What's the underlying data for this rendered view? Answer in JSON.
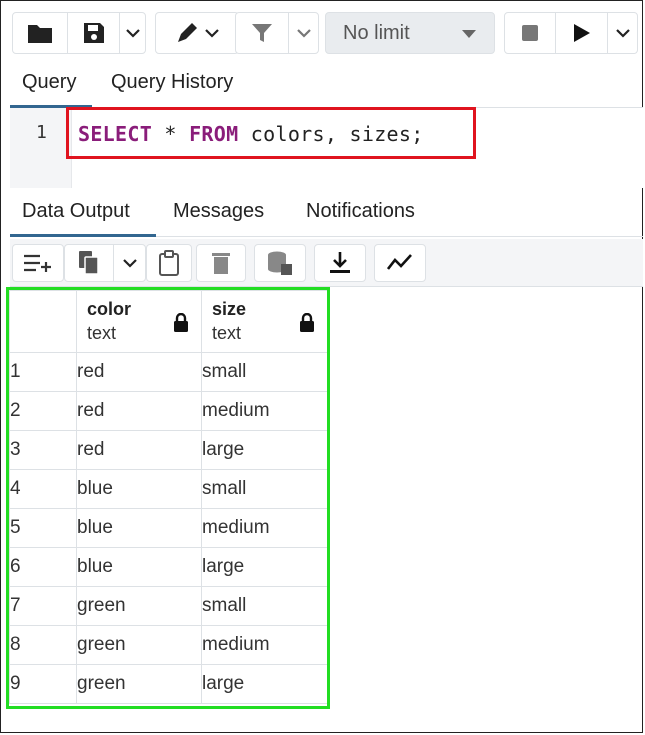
{
  "toolbar": {
    "limit_label": "No limit",
    "icons": [
      "folder-icon",
      "save-icon",
      "chevron-down-icon",
      "pen-icon",
      "chevron-down-icon",
      "filter-icon",
      "chevron-down-icon",
      "caret-down-icon",
      "stop-icon",
      "play-icon",
      "chevron-down-icon"
    ]
  },
  "query_tabs": {
    "query": "Query",
    "history": "Query History"
  },
  "editor": {
    "line_number": "1",
    "code": {
      "kw1": "SELECT",
      "t1": " * ",
      "kw2": "FROM",
      "t2": " colors, sizes;"
    }
  },
  "output_tabs": {
    "data_output": "Data Output",
    "messages": "Messages",
    "notifications": "Notifications"
  },
  "output_toolbar": {
    "icons": [
      "add-row-icon",
      "copy-icon",
      "chevron-down-icon",
      "paste-icon",
      "delete-icon",
      "save-data-icon",
      "download-icon",
      "graph-icon"
    ]
  },
  "grid": {
    "columns": [
      {
        "name": "color",
        "type": "text"
      },
      {
        "name": "size",
        "type": "text"
      }
    ],
    "rows": [
      {
        "n": "1",
        "color": "red",
        "size": "small"
      },
      {
        "n": "2",
        "color": "red",
        "size": "medium"
      },
      {
        "n": "3",
        "color": "red",
        "size": "large"
      },
      {
        "n": "4",
        "color": "blue",
        "size": "small"
      },
      {
        "n": "5",
        "color": "blue",
        "size": "medium"
      },
      {
        "n": "6",
        "color": "blue",
        "size": "large"
      },
      {
        "n": "7",
        "color": "green",
        "size": "small"
      },
      {
        "n": "8",
        "color": "green",
        "size": "medium"
      },
      {
        "n": "9",
        "color": "green",
        "size": "large"
      }
    ]
  },
  "colors": {
    "accent": "#326690",
    "keyword": "#8a1d7a",
    "highlight_query": "#e0141f",
    "highlight_result": "#22dd22"
  }
}
